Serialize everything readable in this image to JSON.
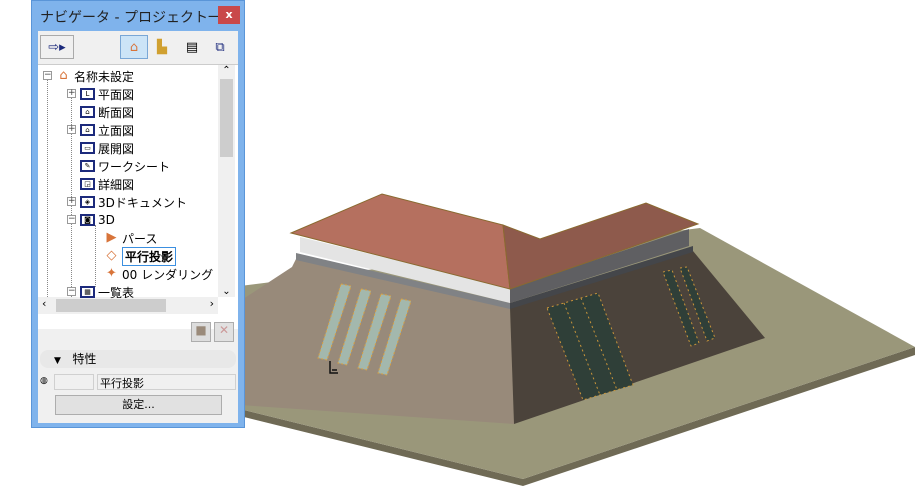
{
  "window": {
    "title": "ナビゲータ - プロジェクト一覧",
    "close": "x"
  },
  "toolbar": {
    "publish": "⇨",
    "project_map": "project-map",
    "view_map": "view-map",
    "layout_book": "layout-book",
    "publisher": "publisher"
  },
  "tree": [
    {
      "label": "名称未設定",
      "expander": "−"
    },
    {
      "label": "平面図",
      "expander": "+"
    },
    {
      "label": "断面図",
      "expander": ""
    },
    {
      "label": "立面図",
      "expander": "+"
    },
    {
      "label": "展開図",
      "expander": ""
    },
    {
      "label": "ワークシート",
      "expander": ""
    },
    {
      "label": "詳細図",
      "expander": ""
    },
    {
      "label": "3Dドキュメント",
      "expander": "+"
    },
    {
      "label": "3D",
      "expander": "−"
    },
    {
      "label": "パース",
      "expander": ""
    },
    {
      "label": "平行投影",
      "expander": ""
    },
    {
      "label": "00 レンダリング",
      "expander": ""
    },
    {
      "label": "一覧表",
      "expander": "−"
    }
  ],
  "properties": {
    "header": "特性",
    "id_value": "",
    "name_value": "平行投影",
    "settings_button": "設定..."
  },
  "colors": {
    "titlebar": "#7fb3ec",
    "close": "#c9484a",
    "roof": "#b5705f",
    "ground": "#9a977a"
  }
}
